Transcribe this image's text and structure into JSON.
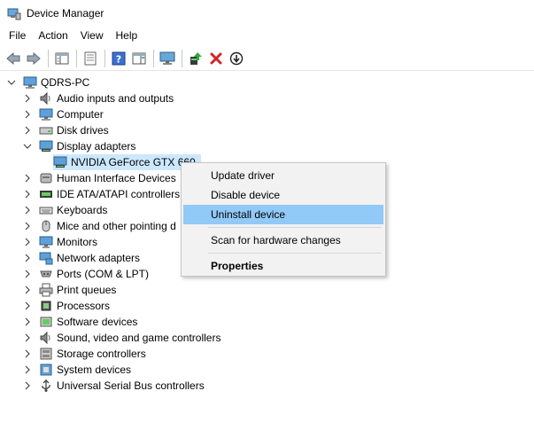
{
  "window": {
    "title": "Device Manager",
    "icon": "device-manager-icon"
  },
  "menubar": {
    "items": [
      "File",
      "Action",
      "View",
      "Help"
    ]
  },
  "toolbar": {
    "buttons": [
      "back-icon",
      "forward-icon",
      "show-hide-console-tree-icon",
      "properties-icon",
      "help-icon",
      "action-pane-icon",
      "monitor-icon",
      "update-driver-icon",
      "uninstall-icon",
      "disable-device-icon"
    ]
  },
  "tree": {
    "root": "QDRS-PC",
    "categories": [
      {
        "label": "Audio inputs and outputs",
        "icon": "speaker-icon",
        "expanded": false
      },
      {
        "label": "Computer",
        "icon": "computer-icon",
        "expanded": false
      },
      {
        "label": "Disk drives",
        "icon": "disk-drive-icon",
        "expanded": false
      },
      {
        "label": "Display adapters",
        "icon": "display-adapter-icon",
        "expanded": true,
        "children": [
          {
            "label": "NVIDIA GeForce GTX 660",
            "icon": "display-adapter-icon",
            "selected": true
          }
        ]
      },
      {
        "label": "Human Interface Devices",
        "icon": "hid-icon",
        "expanded": false
      },
      {
        "label": "IDE ATA/ATAPI controllers",
        "icon": "ide-controller-icon",
        "expanded": false
      },
      {
        "label": "Keyboards",
        "icon": "keyboard-icon",
        "expanded": false
      },
      {
        "label": "Mice and other pointing d",
        "icon": "mouse-icon",
        "expanded": false
      },
      {
        "label": "Monitors",
        "icon": "monitor-icon",
        "expanded": false
      },
      {
        "label": "Network adapters",
        "icon": "network-adapter-icon",
        "expanded": false
      },
      {
        "label": "Ports (COM & LPT)",
        "icon": "port-icon",
        "expanded": false
      },
      {
        "label": "Print queues",
        "icon": "printer-icon",
        "expanded": false
      },
      {
        "label": "Processors",
        "icon": "processor-icon",
        "expanded": false
      },
      {
        "label": "Software devices",
        "icon": "software-device-icon",
        "expanded": false
      },
      {
        "label": "Sound, video and game controllers",
        "icon": "speaker-icon",
        "expanded": false
      },
      {
        "label": "Storage controllers",
        "icon": "storage-controller-icon",
        "expanded": false
      },
      {
        "label": "System devices",
        "icon": "system-device-icon",
        "expanded": false
      },
      {
        "label": "Universal Serial Bus controllers",
        "icon": "usb-icon",
        "expanded": false
      }
    ]
  },
  "context_menu": {
    "items": [
      {
        "label": "Update driver"
      },
      {
        "label": "Disable device"
      },
      {
        "label": "Uninstall device",
        "highlighted": true
      },
      {
        "label": "Scan for hardware changes"
      },
      {
        "label": "Properties",
        "bold": true
      }
    ]
  },
  "colors": {
    "selection": "#cce8ff",
    "menu_highlight": "#91c9f7",
    "menu_background": "#f2f2f2"
  }
}
